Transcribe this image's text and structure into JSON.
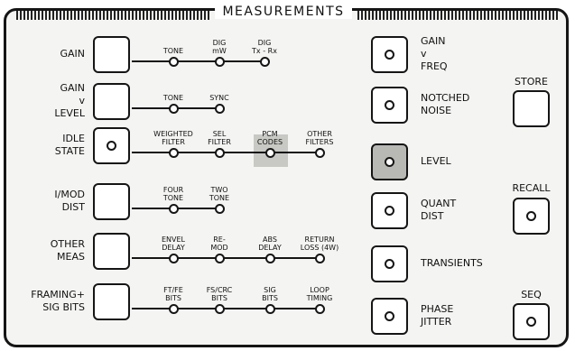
{
  "title": "MEASUREMENTS",
  "left_rows": [
    {
      "id": "gain",
      "label": [
        "GAIN"
      ],
      "lamp": false,
      "options": [
        {
          "id": "tone",
          "label": [
            "TONE"
          ],
          "lamp": false
        },
        {
          "id": "dig-mw",
          "label": [
            "DIG",
            "mW"
          ],
          "lamp": false
        },
        {
          "id": "dig-txrx",
          "label": [
            "DIG",
            "Tx - Rx"
          ],
          "lamp": false
        }
      ]
    },
    {
      "id": "gain-v-level",
      "label": [
        "GAIN",
        "v",
        "LEVEL"
      ],
      "lamp": false,
      "options": [
        {
          "id": "tone",
          "label": [
            "TONE"
          ],
          "lamp": false
        },
        {
          "id": "sync",
          "label": [
            "SYNC"
          ],
          "lamp": false
        }
      ]
    },
    {
      "id": "idle-state",
      "label": [
        "IDLE",
        "STATE"
      ],
      "lamp": true,
      "options": [
        {
          "id": "weighted-filter",
          "label": [
            "WEIGHTED",
            "FILTER"
          ],
          "lamp": false
        },
        {
          "id": "sel-filter",
          "label": [
            "SEL",
            "FILTER"
          ],
          "lamp": false
        },
        {
          "id": "pcm-codes",
          "label": [
            "PCM",
            "CODES"
          ],
          "lamp": false,
          "highlighted": true
        },
        {
          "id": "other-filters",
          "label": [
            "OTHER",
            "FILTERS"
          ],
          "lamp": false
        }
      ]
    },
    {
      "id": "i-mod-dist",
      "label": [
        "I/MOD",
        "DIST"
      ],
      "lamp": false,
      "options": [
        {
          "id": "four-tone",
          "label": [
            "FOUR",
            "TONE"
          ],
          "lamp": false
        },
        {
          "id": "two-tone",
          "label": [
            "TWO",
            "TONE"
          ],
          "lamp": false
        }
      ]
    },
    {
      "id": "other-meas",
      "label": [
        "OTHER",
        "MEAS"
      ],
      "lamp": false,
      "options": [
        {
          "id": "envel-delay",
          "label": [
            "ENVEL",
            "DELAY"
          ],
          "lamp": false
        },
        {
          "id": "re-mod",
          "label": [
            "RE-",
            "MOD"
          ],
          "lamp": false
        },
        {
          "id": "abs-delay",
          "label": [
            "ABS",
            "DELAY"
          ],
          "lamp": false
        },
        {
          "id": "return-loss",
          "label": [
            "RETURN",
            "LOSS (4W)"
          ],
          "lamp": false
        }
      ]
    },
    {
      "id": "framing-sig-bits",
      "label": [
        "FRAMING+",
        "SIG BITS"
      ],
      "lamp": false,
      "options": [
        {
          "id": "ft-fe-bits",
          "label": [
            "FT/FE",
            "BITS"
          ],
          "lamp": false
        },
        {
          "id": "fs-crc-bits",
          "label": [
            "FS/CRC",
            "BITS"
          ],
          "lamp": false
        },
        {
          "id": "sig-bits",
          "label": [
            "SIG",
            "BITS"
          ],
          "lamp": false
        },
        {
          "id": "loop-timing",
          "label": [
            "LOOP",
            "TIMING"
          ],
          "lamp": false
        }
      ]
    }
  ],
  "right_rows": [
    {
      "id": "gain-v-freq",
      "label": [
        "GAIN",
        "v",
        "FREQ"
      ],
      "lamp": false,
      "highlighted": false
    },
    {
      "id": "notched-noise",
      "label": [
        "NOTCHED",
        "NOISE"
      ],
      "lamp": false,
      "highlighted": false
    },
    {
      "id": "level",
      "label": [
        "LEVEL"
      ],
      "lamp": true,
      "highlighted": true
    },
    {
      "id": "quant-dist",
      "label": [
        "QUANT",
        "DIST"
      ],
      "lamp": false,
      "highlighted": false
    },
    {
      "id": "transients",
      "label": [
        "TRANSIENTS"
      ],
      "lamp": false,
      "highlighted": false
    },
    {
      "id": "phase-jitter",
      "label": [
        "PHASE",
        "JITTER"
      ],
      "lamp": false,
      "highlighted": false
    }
  ],
  "side_keys": [
    {
      "id": "store",
      "label": "STORE",
      "lamp": false
    },
    {
      "id": "recall",
      "label": "RECALL",
      "lamp": false
    },
    {
      "id": "seq",
      "label": "SEQ",
      "lamp": false
    }
  ],
  "colors": {
    "ink": "#151515",
    "panel": "#f4f4f2",
    "shade": "#b8b8b4"
  },
  "lamp_icon": "indicator-lamp-icon"
}
